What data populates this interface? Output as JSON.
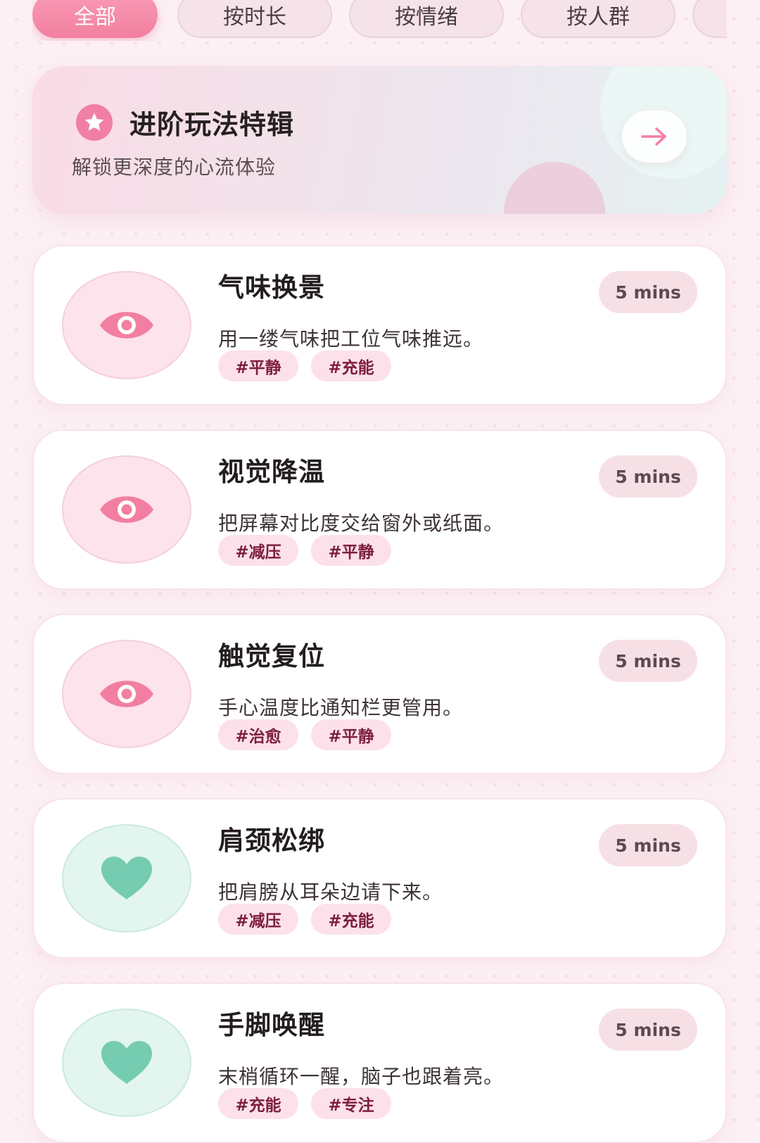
{
  "filters": [
    {
      "label": "全部",
      "active": true
    },
    {
      "label": "按时长",
      "active": false
    },
    {
      "label": "按情绪",
      "active": false
    },
    {
      "label": "按人群",
      "active": false
    }
  ],
  "banner": {
    "title": "进阶玩法特辑",
    "subtitle": "解锁更深度的心流体验",
    "icon": "star-icon",
    "action_icon": "arrow-right-icon"
  },
  "cards": [
    {
      "title": "气味换景",
      "duration": "5 mins",
      "desc": "用一缕气味把工位气味推远。",
      "tags": [
        "#平静",
        "#充能"
      ],
      "icon": "eye-icon",
      "theme": "pink"
    },
    {
      "title": "视觉降温",
      "duration": "5 mins",
      "desc": "把屏幕对比度交给窗外或纸面。",
      "tags": [
        "#减压",
        "#平静"
      ],
      "icon": "eye-icon",
      "theme": "pink"
    },
    {
      "title": "触觉复位",
      "duration": "5 mins",
      "desc": "手心温度比通知栏更管用。",
      "tags": [
        "#治愈",
        "#平静"
      ],
      "icon": "eye-icon",
      "theme": "pink"
    },
    {
      "title": "肩颈松绑",
      "duration": "5 mins",
      "desc": "把肩膀从耳朵边请下来。",
      "tags": [
        "#减压",
        "#充能"
      ],
      "icon": "heart-icon",
      "theme": "mint"
    },
    {
      "title": "手脚唤醒",
      "duration": "5 mins",
      "desc": "末梢循环一醒，脑子也跟着亮。",
      "tags": [
        "#充能",
        "#专注"
      ],
      "icon": "heart-icon",
      "theme": "mint"
    }
  ],
  "colors": {
    "accent_pink": "#f17fa3",
    "icon_pink": "#f27ea2",
    "icon_mint": "#76ccb0",
    "tag_text": "#7d1e40",
    "page_bg": "#fcf0f4"
  }
}
